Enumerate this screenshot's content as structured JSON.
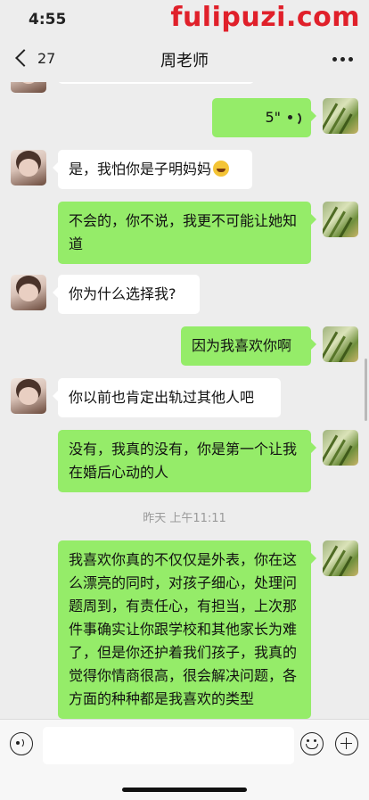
{
  "status_bar": {
    "time": "4:55"
  },
  "watermark": "fulipuzi.com",
  "nav": {
    "back_count": "27",
    "title": "周老师"
  },
  "messages": {
    "m1": {
      "duration": "5\""
    },
    "m2": {
      "text": "是，我怕你是子明妈妈"
    },
    "m3": {
      "text": "不会的，你不说，我更不可能让她知道"
    },
    "m4": {
      "text": "你为什么选择我?"
    },
    "m5": {
      "text": "因为我喜欢你啊"
    },
    "m6": {
      "text": "你以前也肯定出轨过其他人吧"
    },
    "m7": {
      "text": "没有，我真的没有，你是第一个让我在婚后心动的人"
    },
    "timestamp": "昨天 上午11:11",
    "m8": {
      "text": "我喜欢你真的不仅仅是外表，你在这么漂亮的同时，对孩子细心，处理问题周到，有责任心，有担当，上次那件事确实让你跟学校和其他家长为难了，但是你还护着我们孩子，我真的觉得你情商很高，很会解决问题，各方面的种种都是我喜欢的类型"
    }
  },
  "input_bar": {
    "placeholder": ""
  },
  "icons": {
    "back": "chevron-left-icon",
    "more": "more-dots-icon",
    "voice": "voice-icon",
    "emoji": "emoji-icon",
    "plus": "plus-icon"
  },
  "colors": {
    "bubble_sent": "#95ec69",
    "bubble_received": "#ffffff",
    "background": "#ededed"
  }
}
